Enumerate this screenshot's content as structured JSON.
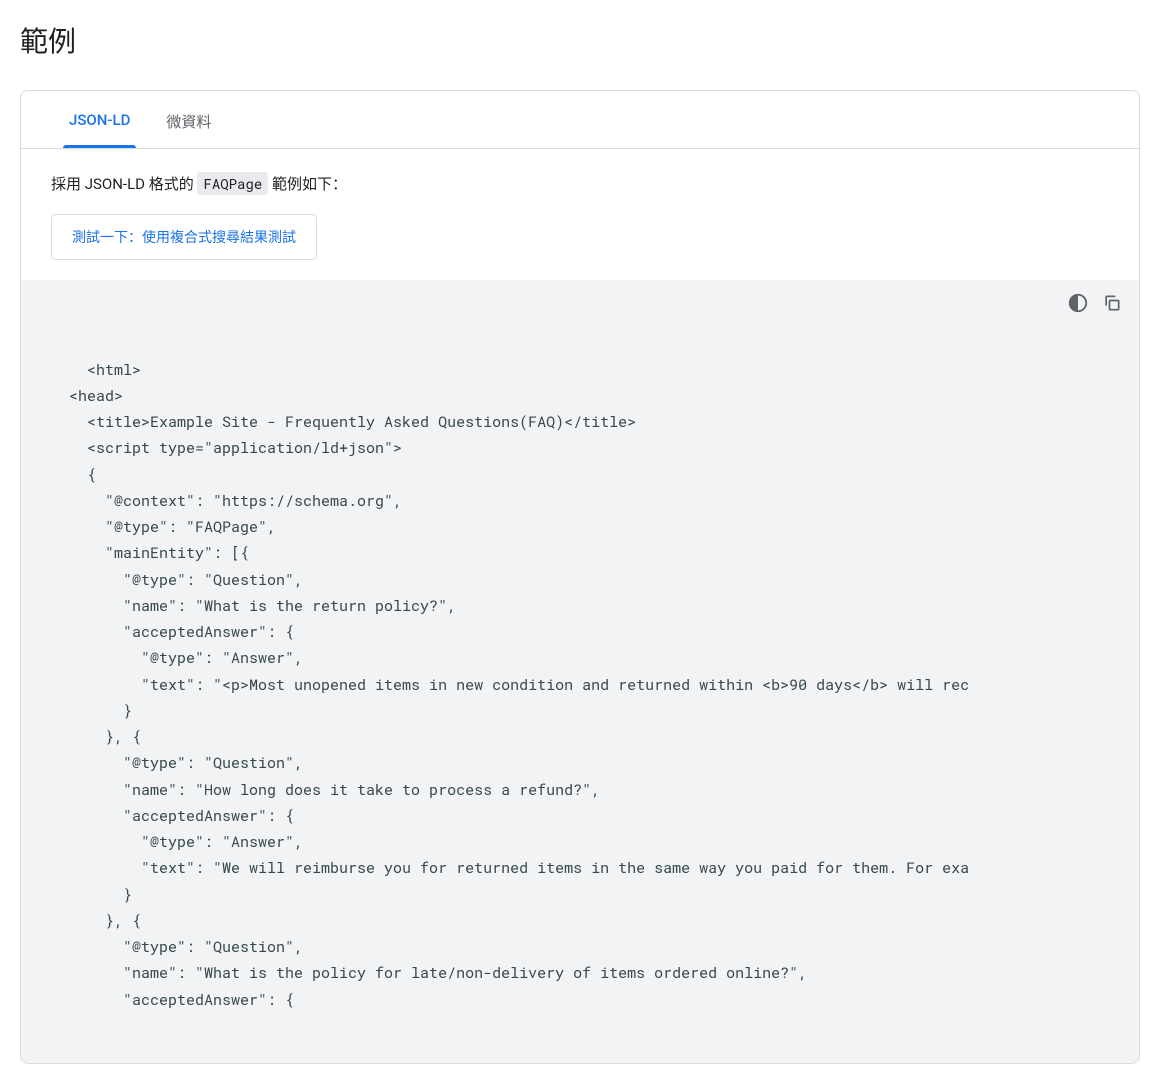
{
  "page_title": "範例",
  "tabs": [
    {
      "label": "JSON-LD",
      "active": true
    },
    {
      "label": "微資料",
      "active": false
    }
  ],
  "description": {
    "prefix": "採用 JSON-LD 格式的 ",
    "code": "FAQPage",
    "suffix": " 範例如下："
  },
  "test_button_label": "測試一下：使用複合式搜尋結果測試",
  "code_example": "<html>\n  <head>\n    <title>Example Site - Frequently Asked Questions(FAQ)</title>\n    <script type=\"application/ld+json\">\n    {\n      \"@context\": \"https://schema.org\",\n      \"@type\": \"FAQPage\",\n      \"mainEntity\": [{\n        \"@type\": \"Question\",\n        \"name\": \"What is the return policy?\",\n        \"acceptedAnswer\": {\n          \"@type\": \"Answer\",\n          \"text\": \"<p>Most unopened items in new condition and returned within <b>90 days</b> will rec\n        }\n      }, {\n        \"@type\": \"Question\",\n        \"name\": \"How long does it take to process a refund?\",\n        \"acceptedAnswer\": {\n          \"@type\": \"Answer\",\n          \"text\": \"We will reimburse you for returned items in the same way you paid for them. For exa\n        }\n      }, {\n        \"@type\": \"Question\",\n        \"name\": \"What is the policy for late/non-delivery of items ordered online?\",\n        \"acceptedAnswer\": {"
}
